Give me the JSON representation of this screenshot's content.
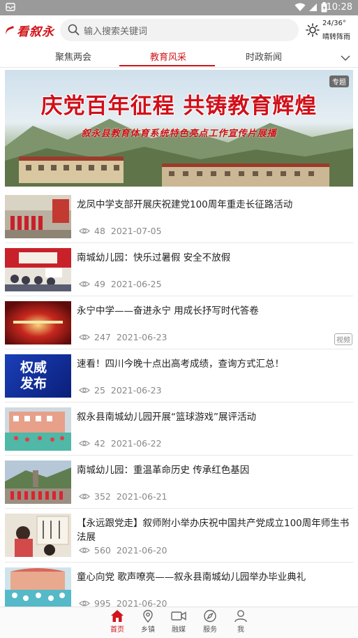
{
  "status_bar": {
    "time": "10:28"
  },
  "app": {
    "logo_text": "看叙永",
    "brand_color": "#d0151b"
  },
  "search": {
    "placeholder": "输入搜索关键词"
  },
  "weather": {
    "temp": "24/36°",
    "desc": "晴转阵雨"
  },
  "tabs": [
    {
      "label": "聚焦两会",
      "active": false
    },
    {
      "label": "教育风采",
      "active": true
    },
    {
      "label": "时政新闻",
      "active": false
    }
  ],
  "banner": {
    "title": "庆党百年征程 共铸教育辉煌",
    "subtitle": "叙永县教育体育系统特色亮点工作宣传片展播",
    "badge": "专题"
  },
  "articles": [
    {
      "title": "龙凤中学支部开展庆祝建党100周年重走长征路活动",
      "views": "48",
      "date": "2021-07-05",
      "tag": ""
    },
    {
      "title": "南城幼儿园：快乐过暑假 安全不放假",
      "views": "49",
      "date": "2021-06-25",
      "tag": ""
    },
    {
      "title": "永宁中学——奋进永宁 用成长抒写时代答卷",
      "views": "247",
      "date": "2021-06-23",
      "tag": "视频"
    },
    {
      "title": "速看！四川今晚十点出高考成绩，查询方式汇总！",
      "views": "25",
      "date": "2021-06-23",
      "tag": "",
      "thumb_text": "权威发布"
    },
    {
      "title": "叙永县南城幼儿园开展“篮球游戏”展评活动",
      "views": "42",
      "date": "2021-06-22",
      "tag": ""
    },
    {
      "title": "南城幼儿园：重温革命历史 传承红色基因",
      "views": "352",
      "date": "2021-06-21",
      "tag": ""
    },
    {
      "title": "【永远跟党走】叙师附小举办庆祝中国共产党成立100周年师生书法展",
      "views": "560",
      "date": "2021-06-20",
      "tag": ""
    },
    {
      "title": "童心向党 歌声嘹亮——叙永县南城幼儿园举办毕业典礼",
      "views": "995",
      "date": "2021-06-20",
      "tag": ""
    }
  ],
  "bottom_nav": [
    {
      "label": "首页",
      "icon": "home-icon",
      "active": true
    },
    {
      "label": "乡镇",
      "icon": "location-pin-icon",
      "active": false
    },
    {
      "label": "融媒",
      "icon": "video-camera-icon",
      "active": false
    },
    {
      "label": "服务",
      "icon": "compass-icon",
      "active": false
    },
    {
      "label": "我",
      "icon": "person-icon",
      "active": false
    }
  ]
}
